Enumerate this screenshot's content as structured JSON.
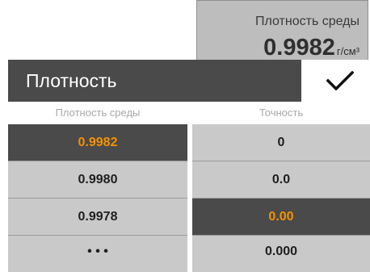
{
  "summary": {
    "title": "Плотность среды",
    "value": "0.9982",
    "unit": "г/см³"
  },
  "header": {
    "title": "Плотность",
    "confirm_icon": "checkmark-icon"
  },
  "columns": {
    "density": {
      "header": "Плотность среды",
      "items": [
        "0.9982",
        "0.9980",
        "0.9978",
        "• • •"
      ],
      "selected_index": 0
    },
    "precision": {
      "header": "Точность",
      "items": [
        "0",
        "0.0",
        "0.00",
        "0.000"
      ],
      "selected_index": 2
    }
  },
  "colors": {
    "header_bg": "#4a4a4a",
    "row_bg": "#c9c9c9",
    "accent": "#f39200",
    "summary_bg": "#bdbdbd"
  }
}
